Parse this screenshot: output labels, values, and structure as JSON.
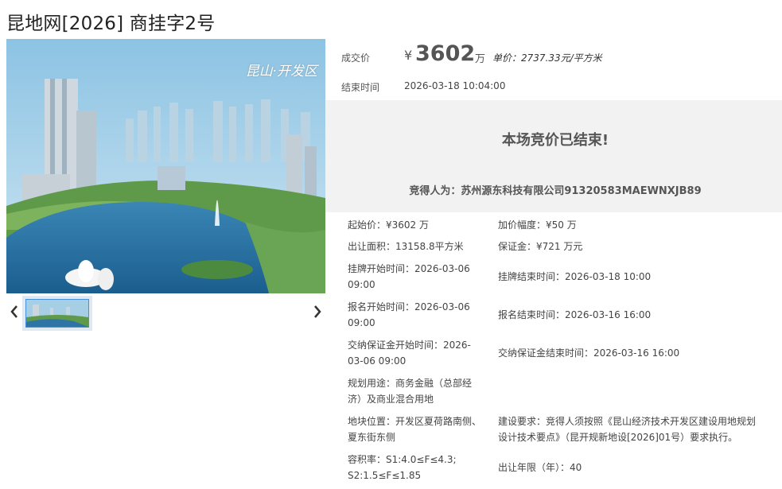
{
  "page": {
    "title": "昆地网[2026] 商挂字2号"
  },
  "photo": {
    "caption": "昆山·开发区"
  },
  "carousel": {
    "prev_icon": "chevron-left",
    "next_icon": "chevron-right"
  },
  "deal": {
    "price_label": "成交价",
    "currency": "¥",
    "price": "3602",
    "price_unit": "万",
    "unit_price": "单价：2737.33元/平方米",
    "end_label": "结束时间",
    "end_time": "2026-03-18 10:04:00"
  },
  "banner": {
    "status": "本场竞价已结束!",
    "winner": "竞得人为：苏州源东科技有限公司91320583MAEWNXJB89"
  },
  "details": {
    "start_price_label": "起始价：",
    "start_price": "¥3602 万",
    "increment_label": "加价幅度：",
    "increment": "¥50 万",
    "area_label": "出让面积：",
    "area": "13158.8平方米",
    "deposit_label": "保证金：",
    "deposit": "¥721 万元",
    "listing_start_label": "挂牌开始时间：",
    "listing_start_a": "2026-03-06",
    "listing_start_b": "09:00",
    "listing_end_label": "挂牌结束时间：",
    "listing_end": "2026-03-18 10:00",
    "signup_start_label": "报名开始时间：",
    "signup_start_a": "2026-03-06",
    "signup_start_b": "09:00",
    "signup_end_label": "报名结束时间：",
    "signup_end": "2026-03-16 16:00",
    "deposit_start_label": "交纳保证金开始时间：",
    "deposit_start_a": "2026-",
    "deposit_start_b": "03-06 09:00",
    "deposit_end_label": "交纳保证金结束时间：",
    "deposit_end": "2026-03-16 16:00",
    "usage_label": "规划用途：",
    "usage_a": "商务金融（总部经",
    "usage_b": "济）及商业混合用地",
    "location_label": "地块位置：",
    "location_a": "开发区夏荷路南侧、",
    "location_b": "夏东街东侧",
    "requirement_label": "建设要求：",
    "requirement_a": "竞得人须按照《昆山经济技术开发区建设用地规划",
    "requirement_b": "设计技术要点》（昆开规新地设[2026]01号）要求执行。",
    "far_label": "容积率：",
    "far_a": "S1:4.0≤F≤4.3;",
    "far_b": "S2:1.5≤F≤1.85",
    "term_label": "出让年限（年）：",
    "term": "40"
  }
}
